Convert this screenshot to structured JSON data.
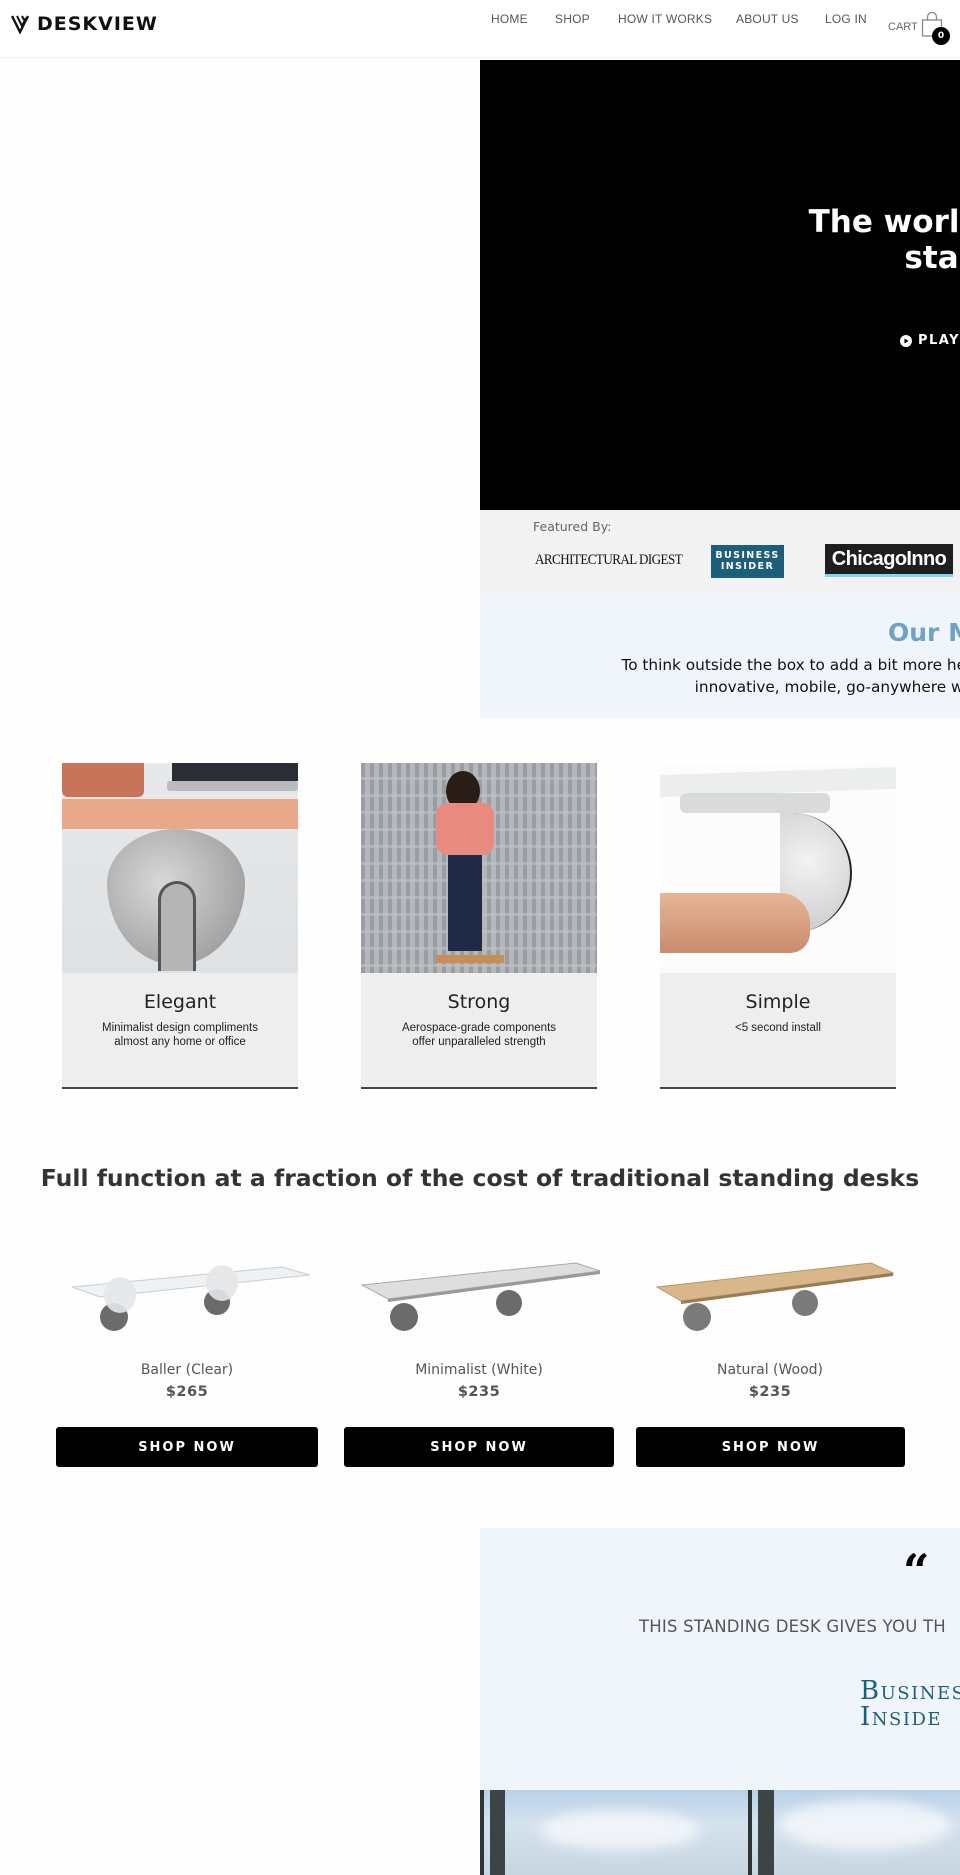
{
  "header": {
    "brand": "DESKVIEW",
    "nav": [
      {
        "label": "HOME"
      },
      {
        "label": "SHOP"
      },
      {
        "label": "HOW IT WORKS"
      },
      {
        "label": "ABOUT US"
      },
      {
        "label": "LOG IN"
      }
    ],
    "cart": {
      "label": "CART",
      "count": "0",
      "icon": "shopping-bag-icon"
    }
  },
  "hero": {
    "title": "The world's first w\nstandin",
    "play_label": "PLAY",
    "play_icon": "play-circle-icon"
  },
  "featured": {
    "label": "Featured By:",
    "logos": [
      {
        "name": "ARCHITECTURAL DIGEST"
      },
      {
        "name": "BUSINESS\nINSIDER"
      },
      {
        "name": "ChicagoInno"
      }
    ]
  },
  "mission": {
    "title": "Our M",
    "text": "To think outside the box to add a bit more health and enjoym\ninnovative, mobile, go-anywhere workstat"
  },
  "features": [
    {
      "title": "Elegant",
      "description": "Minimalist design compliments\nalmost any home or office"
    },
    {
      "title": "Strong",
      "description": "Aerospace-grade components\noffer unparalleled strength"
    },
    {
      "title": "Simple",
      "description": "<5 second install"
    }
  ],
  "comparison": {
    "title": "Full function at a fraction of the cost of traditional standing desks"
  },
  "products": [
    {
      "name": "Baller (Clear)",
      "price": "$265",
      "button": "SHOP NOW",
      "color": "#eef2f4"
    },
    {
      "name": "Minimalist (White)",
      "price": "$235",
      "button": "SHOP NOW",
      "color": "#dcdcdc"
    },
    {
      "name": "Natural (Wood)",
      "price": "$235",
      "button": "SHOP NOW",
      "color": "#d8b88a"
    }
  ],
  "testimonial": {
    "quote_mark": "“",
    "quote": "THIS STANDING DESK GIVES YOU TH",
    "source": "Busines\nInside"
  },
  "colors": {
    "accent_blue": "#6fa3c6",
    "business_insider": "#1d5e7b",
    "mission_bg": "#f0f5fc",
    "featured_bg": "#f2f2f2",
    "card_bg": "#eeeeee"
  }
}
